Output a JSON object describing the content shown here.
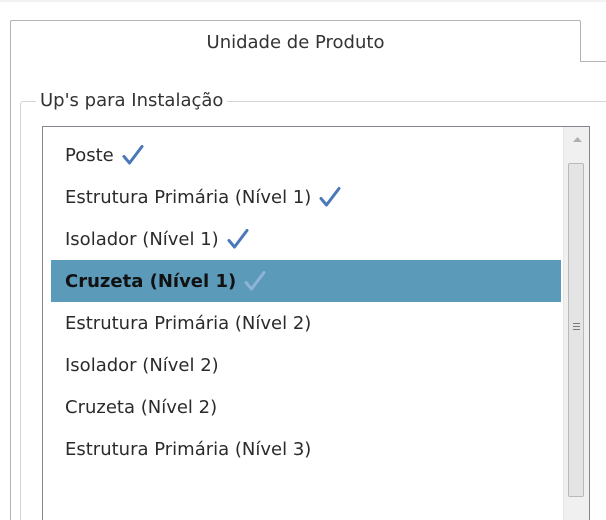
{
  "tab": {
    "title": "Unidade de Produto"
  },
  "group": {
    "legend": "Up's para Instalação"
  },
  "list": {
    "items": [
      {
        "label": "Poste",
        "checked": true,
        "selected": false
      },
      {
        "label": "Estrutura Primária (Nível 1)",
        "checked": true,
        "selected": false
      },
      {
        "label": "Isolador (Nível 1)",
        "checked": true,
        "selected": false
      },
      {
        "label": "Cruzeta (Nível 1)",
        "checked": true,
        "selected": true
      },
      {
        "label": "Estrutura Primária (Nível 2)",
        "checked": false,
        "selected": false
      },
      {
        "label": "Isolador (Nível 2)",
        "checked": false,
        "selected": false
      },
      {
        "label": "Cruzeta (Nível 2)",
        "checked": false,
        "selected": false
      },
      {
        "label": "Estrutura Primária (Nível 3)",
        "checked": false,
        "selected": false
      }
    ],
    "check_icon": "checkmark-icon"
  },
  "colors": {
    "selection": "#5b9ab9",
    "check": "#4a78b8",
    "check_on_selection": "#8fb3d6"
  }
}
